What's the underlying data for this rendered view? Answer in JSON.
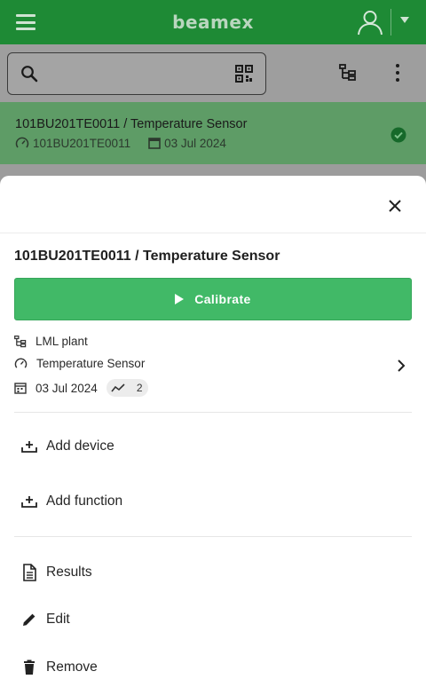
{
  "appbar": {
    "brand": "beamex"
  },
  "search": {
    "placeholder": ""
  },
  "list_item": {
    "title": "101BU201TE0011 / Temperature Sensor",
    "tag": "101BU201TE0011",
    "date": "03 Jul 2024",
    "status_icon": "check-circle-icon"
  },
  "sheet": {
    "title": "101BU201TE0011 / Temperature Sensor",
    "calibrate_label": "Calibrate",
    "plant": "LML plant",
    "device_type": "Temperature Sensor",
    "date": "03 Jul 2024",
    "results_count": "2",
    "actions": {
      "add_device": "Add device",
      "add_function": "Add function",
      "results": "Results",
      "edit": "Edit",
      "remove": "Remove"
    }
  },
  "colors": {
    "appbar": "#1e8a35",
    "calibrate": "#41b967",
    "selected_item": "#5e9c66"
  }
}
